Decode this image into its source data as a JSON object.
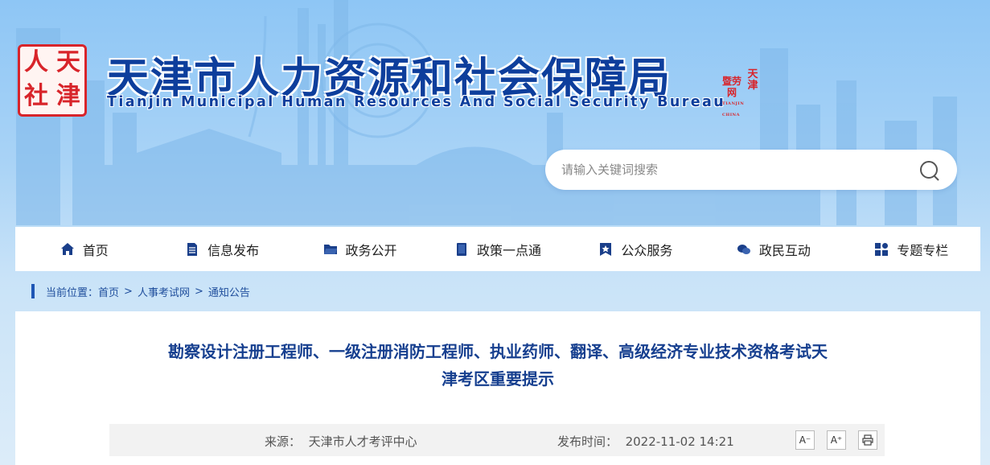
{
  "header": {
    "seal_chars": [
      "人",
      "天",
      "社",
      "津"
    ],
    "title_cn": "天津市人力资源和社会保障局",
    "title_en": "Tianjin Municipal Human Resources And Social Security Bureau",
    "mini_seal_tj": "天津",
    "mini_seal_left": "暨劳网",
    "mini_seal_en": "TIANJIN CHINA"
  },
  "search": {
    "placeholder": "请输入关键词搜索"
  },
  "nav": [
    {
      "label": "首页",
      "icon": "home-icon"
    },
    {
      "label": "信息发布",
      "icon": "document-icon"
    },
    {
      "label": "政务公开",
      "icon": "folder-icon"
    },
    {
      "label": "政策一点通",
      "icon": "book-icon"
    },
    {
      "label": "公众服务",
      "icon": "star-badge-icon"
    },
    {
      "label": "政民互动",
      "icon": "chat-icon"
    },
    {
      "label": "专题专栏",
      "icon": "grid-icon"
    }
  ],
  "breadcrumb": {
    "prefix": "当前位置：",
    "items": [
      "首页",
      "人事考试网",
      "通知公告"
    ],
    "separator": ">"
  },
  "article": {
    "title_line1": "勘察设计注册工程师、一级注册消防工程师、执业药师、翻译、高级经济专业技术资格考试天",
    "title_line2": "津考区重要提示",
    "source_label": "来源：",
    "source_value": "天津市人才考评中心",
    "time_label": "发布时间：",
    "time_value": "2022-11-02 14:21",
    "font_decrease": "A⁻",
    "font_increase": "A⁺"
  },
  "colors": {
    "brand": "#0d3e9c",
    "seal": "#d8242a",
    "accent": "#1f56b5"
  }
}
